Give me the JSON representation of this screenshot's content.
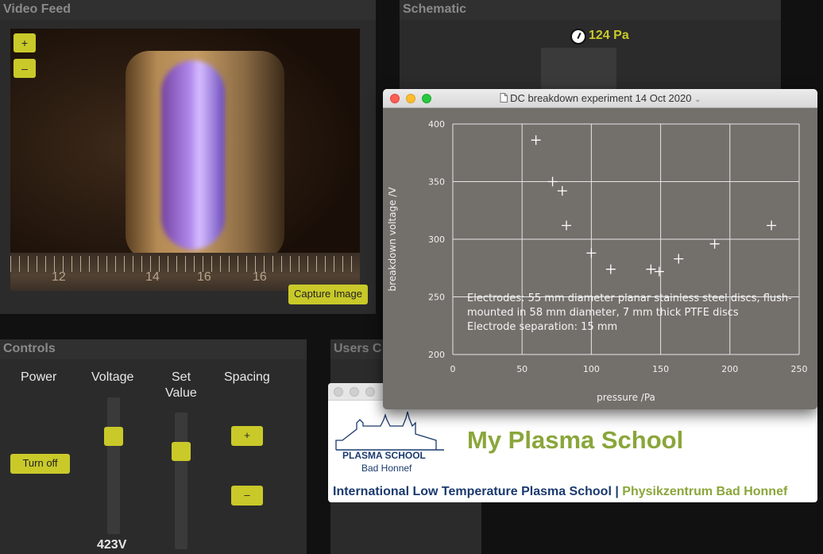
{
  "video_panel": {
    "title": "Video Feed",
    "zoom_in": "+",
    "zoom_out": "–",
    "capture_label": "Capture Image",
    "ruler_labels": [
      "12",
      "14",
      "16",
      "16"
    ]
  },
  "schematic_panel": {
    "title": "Schematic",
    "pressure": "124 Pa"
  },
  "controls_panel": {
    "title": "Controls",
    "power_label": "Power",
    "voltage_label": "Voltage",
    "setvalue_label_1": "Set",
    "setvalue_label_2": "Value",
    "spacing_label": "Spacing",
    "power_button": "Turn off",
    "spacing_plus": "+",
    "spacing_minus": "–",
    "voltage_value": "423V",
    "voltage_slider_fraction": 0.75,
    "setvalue_slider_fraction": 0.75
  },
  "users_panel": {
    "title": "Users C"
  },
  "plasma_school_window": {
    "logo_name": "PLASMA SCHOOL",
    "logo_place": "Bad Honnef",
    "title": "My Plasma School",
    "footer_left": "International Low Temperature Plasma School",
    "footer_sep": " | ",
    "footer_right": "Physikzentrum Bad Honnef",
    "colors": {
      "navy": "#1a3a6e",
      "green": "#8aa63a"
    }
  },
  "plot_window": {
    "title": "DC breakdown experiment 14 Oct 2020",
    "icon": "document-icon"
  },
  "chart_data": {
    "type": "scatter",
    "xlabel": "pressure /Pa",
    "ylabel": "breakdown voltage /V",
    "xlim": [
      0,
      250
    ],
    "ylim": [
      200,
      400
    ],
    "xticks": [
      0,
      50,
      100,
      150,
      200,
      250
    ],
    "yticks": [
      200,
      250,
      300,
      350,
      400
    ],
    "grid": true,
    "marker": "plus",
    "series": [
      {
        "x": [
          60,
          72,
          79,
          82,
          100,
          114,
          143,
          149,
          163,
          189,
          230
        ],
        "y": [
          386,
          350,
          342,
          312,
          288,
          274,
          274,
          272,
          283,
          296,
          312
        ]
      }
    ],
    "annotation": [
      "Electrodes: 55 mm diameter planar stainless steel discs, flush-",
      "mounted in 58 mm diameter,  7 mm thick PTFE discs",
      "Electrode separation: 15 mm"
    ]
  }
}
